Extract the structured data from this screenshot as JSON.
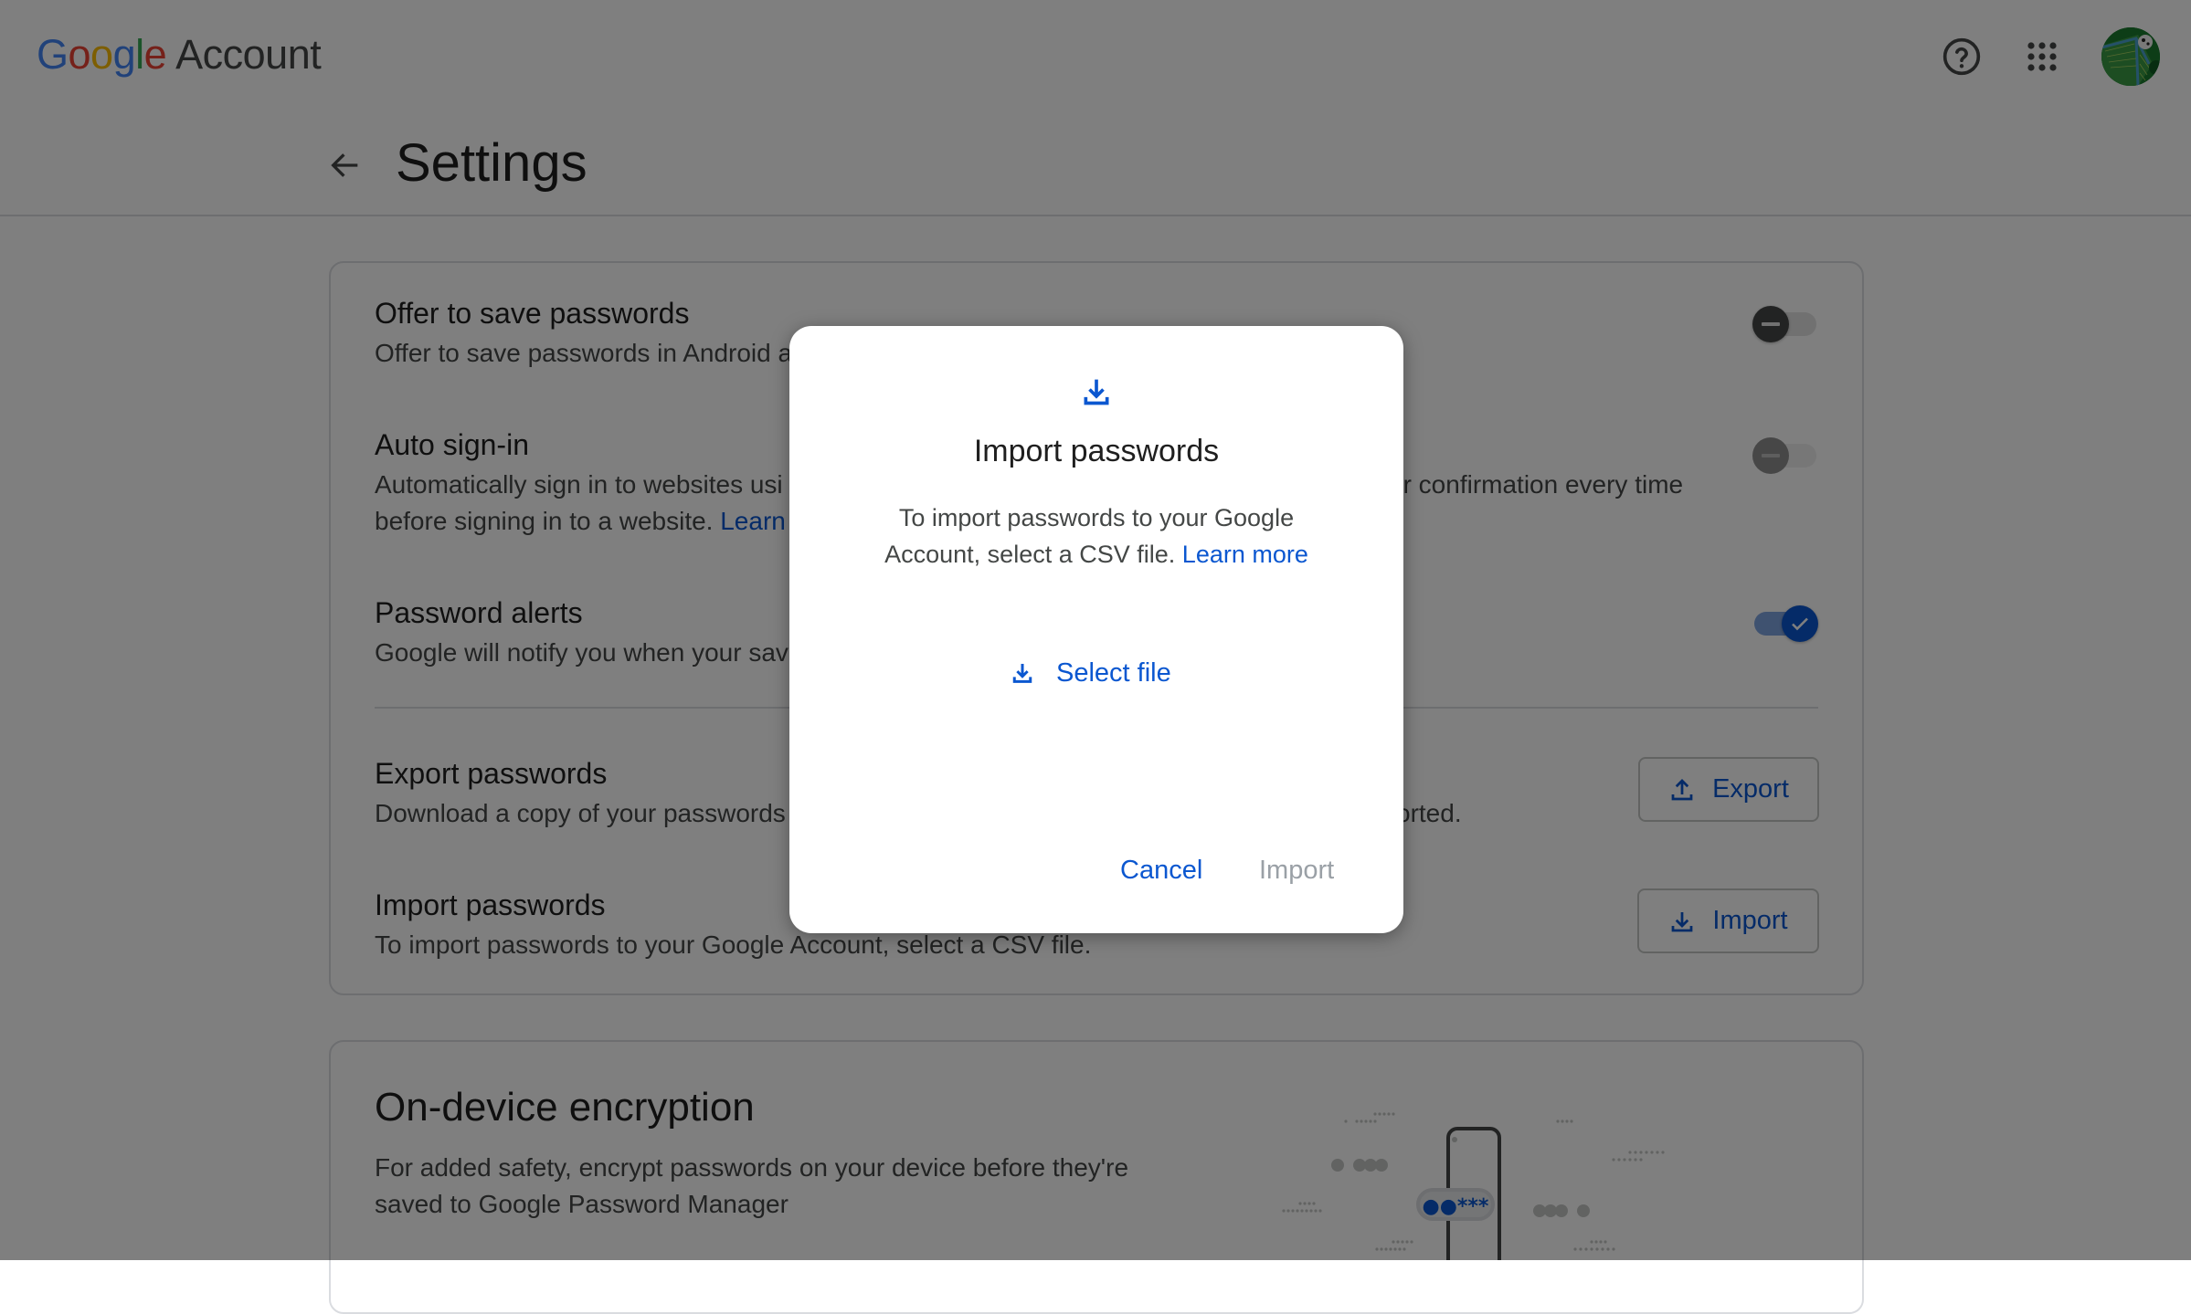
{
  "header": {
    "logo_google": [
      "G",
      "o",
      "o",
      "g",
      "l",
      "e"
    ],
    "logo_product": "Account",
    "help_icon": "help-circle-icon",
    "apps_icon": "apps-grid-icon",
    "avatar_icon": "avatar-image"
  },
  "page": {
    "back_icon": "arrow-back-icon",
    "title": "Settings"
  },
  "settings": {
    "offer_save": {
      "title": "Offer to save passwords",
      "description": "Offer to save passwords in Android a",
      "toggle_state": "off"
    },
    "auto_signin": {
      "title": "Auto sign-in",
      "description_line1_left": "Automatically sign in to websites usi",
      "description_line1_right": "or confirmation every time",
      "description_line2": "before signing in to a website.",
      "link": "Learn",
      "toggle_state": "off-disabled"
    },
    "password_alerts": {
      "title": "Password alerts",
      "description": "Google will notify you when your sav",
      "toggle_state": "on"
    },
    "export": {
      "title": "Export passwords",
      "description_left": "Download a copy of your passwords",
      "description_right": "orted.",
      "button_label": "Export",
      "button_icon": "upload-icon"
    },
    "import": {
      "title": "Import passwords",
      "description": "To import passwords to your Google Account, select a CSV file.",
      "button_label": "Import",
      "button_icon": "download-icon"
    }
  },
  "encryption": {
    "title": "On-device encryption",
    "description_line1": "For added safety, encrypt passwords on your device before they're",
    "description_line2": "saved to Google Password Manager",
    "illustration_password": "●●***"
  },
  "dialog": {
    "icon": "download-icon",
    "title": "Import passwords",
    "text_line1": "To import passwords to your Google",
    "text_line2": "Account, select a CSV file.",
    "learn_more": "Learn more",
    "select_file_label": "Select file",
    "cancel_label": "Cancel",
    "import_label": "Import",
    "import_enabled": false
  },
  "colors": {
    "accent": "#0b57d0",
    "scrim": "#000000"
  }
}
